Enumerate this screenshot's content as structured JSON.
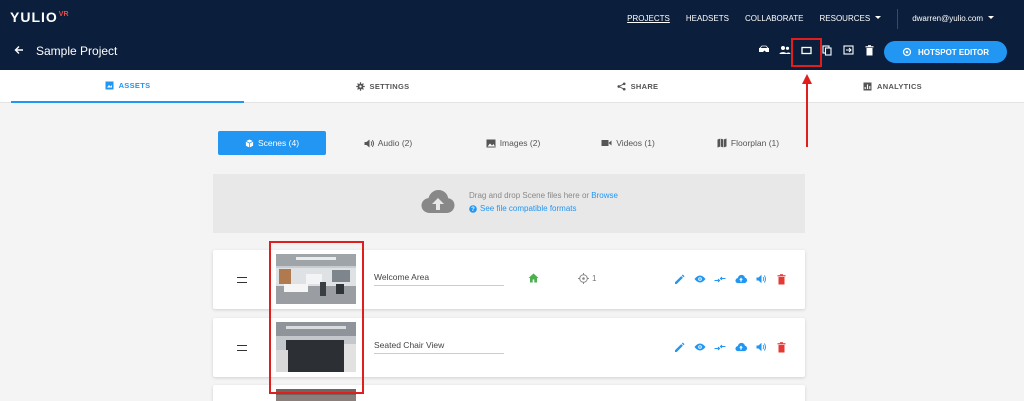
{
  "app": {
    "logo": "YULIO",
    "logo_sup": "VR",
    "nav": [
      {
        "label": "PROJECTS"
      },
      {
        "label": "HEADSETS"
      },
      {
        "label": "COLLABORATE"
      },
      {
        "label": "RESOURCES"
      }
    ],
    "user": "dwarren@yulio.com"
  },
  "project": {
    "title": "Sample Project",
    "toolbar_icons": [
      "headset-icon",
      "people-icon",
      "crop-frame-icon",
      "copy-icon",
      "export-icon",
      "trash-icon"
    ],
    "hotspot_button": "HOTSPOT EDITOR"
  },
  "tabs": [
    {
      "label": "ASSETS",
      "icon": "photo-library-icon",
      "active": true
    },
    {
      "label": "SETTINGS",
      "icon": "gear-icon"
    },
    {
      "label": "SHARE",
      "icon": "share-icon"
    },
    {
      "label": "ANALYTICS",
      "icon": "analytics-icon"
    }
  ],
  "subtabs": [
    {
      "label": "Scenes (4)",
      "icon": "cube-icon",
      "active": true
    },
    {
      "label": "Audio (2)",
      "icon": "speaker-icon"
    },
    {
      "label": "Images (2)",
      "icon": "image-icon"
    },
    {
      "label": "Videos (1)",
      "icon": "video-icon"
    },
    {
      "label": "Floorplan (1)",
      "icon": "map-icon"
    }
  ],
  "dropzone": {
    "text": "Drag and drop Scene files here or ",
    "link": "Browse",
    "formats_link": "See file compatible formats"
  },
  "scenes": [
    {
      "name": "Welcome Area",
      "is_home": true,
      "hotspots": "1"
    },
    {
      "name": "Seated Chair View",
      "is_home": false,
      "hotspots": ""
    }
  ],
  "colors": {
    "navy": "#0b1e3c",
    "accent": "#2196f3",
    "home": "#4caf50",
    "delete": "#e53935",
    "annotation": "#e01e1e"
  }
}
